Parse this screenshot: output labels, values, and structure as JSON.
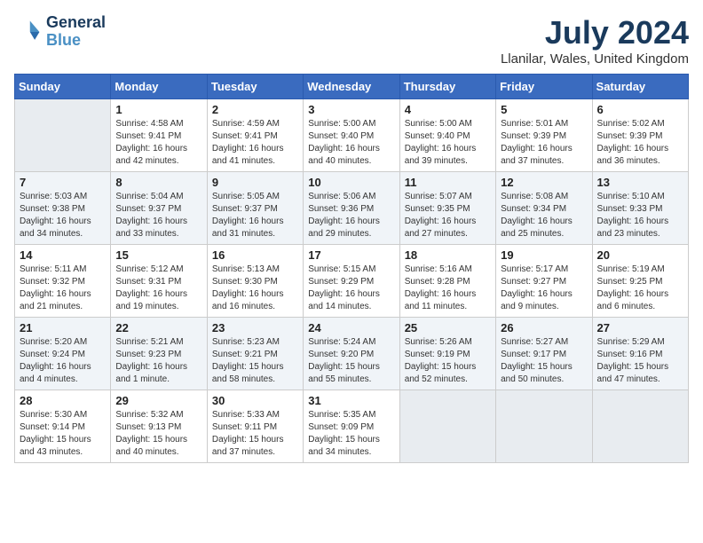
{
  "header": {
    "logo_line1": "General",
    "logo_line2": "Blue",
    "month_title": "July 2024",
    "location": "Llanilar, Wales, United Kingdom"
  },
  "weekdays": [
    "Sunday",
    "Monday",
    "Tuesday",
    "Wednesday",
    "Thursday",
    "Friday",
    "Saturday"
  ],
  "weeks": [
    [
      {
        "day": "",
        "info": ""
      },
      {
        "day": "1",
        "info": "Sunrise: 4:58 AM\nSunset: 9:41 PM\nDaylight: 16 hours\nand 42 minutes."
      },
      {
        "day": "2",
        "info": "Sunrise: 4:59 AM\nSunset: 9:41 PM\nDaylight: 16 hours\nand 41 minutes."
      },
      {
        "day": "3",
        "info": "Sunrise: 5:00 AM\nSunset: 9:40 PM\nDaylight: 16 hours\nand 40 minutes."
      },
      {
        "day": "4",
        "info": "Sunrise: 5:00 AM\nSunset: 9:40 PM\nDaylight: 16 hours\nand 39 minutes."
      },
      {
        "day": "5",
        "info": "Sunrise: 5:01 AM\nSunset: 9:39 PM\nDaylight: 16 hours\nand 37 minutes."
      },
      {
        "day": "6",
        "info": "Sunrise: 5:02 AM\nSunset: 9:39 PM\nDaylight: 16 hours\nand 36 minutes."
      }
    ],
    [
      {
        "day": "7",
        "info": "Sunrise: 5:03 AM\nSunset: 9:38 PM\nDaylight: 16 hours\nand 34 minutes."
      },
      {
        "day": "8",
        "info": "Sunrise: 5:04 AM\nSunset: 9:37 PM\nDaylight: 16 hours\nand 33 minutes."
      },
      {
        "day": "9",
        "info": "Sunrise: 5:05 AM\nSunset: 9:37 PM\nDaylight: 16 hours\nand 31 minutes."
      },
      {
        "day": "10",
        "info": "Sunrise: 5:06 AM\nSunset: 9:36 PM\nDaylight: 16 hours\nand 29 minutes."
      },
      {
        "day": "11",
        "info": "Sunrise: 5:07 AM\nSunset: 9:35 PM\nDaylight: 16 hours\nand 27 minutes."
      },
      {
        "day": "12",
        "info": "Sunrise: 5:08 AM\nSunset: 9:34 PM\nDaylight: 16 hours\nand 25 minutes."
      },
      {
        "day": "13",
        "info": "Sunrise: 5:10 AM\nSunset: 9:33 PM\nDaylight: 16 hours\nand 23 minutes."
      }
    ],
    [
      {
        "day": "14",
        "info": "Sunrise: 5:11 AM\nSunset: 9:32 PM\nDaylight: 16 hours\nand 21 minutes."
      },
      {
        "day": "15",
        "info": "Sunrise: 5:12 AM\nSunset: 9:31 PM\nDaylight: 16 hours\nand 19 minutes."
      },
      {
        "day": "16",
        "info": "Sunrise: 5:13 AM\nSunset: 9:30 PM\nDaylight: 16 hours\nand 16 minutes."
      },
      {
        "day": "17",
        "info": "Sunrise: 5:15 AM\nSunset: 9:29 PM\nDaylight: 16 hours\nand 14 minutes."
      },
      {
        "day": "18",
        "info": "Sunrise: 5:16 AM\nSunset: 9:28 PM\nDaylight: 16 hours\nand 11 minutes."
      },
      {
        "day": "19",
        "info": "Sunrise: 5:17 AM\nSunset: 9:27 PM\nDaylight: 16 hours\nand 9 minutes."
      },
      {
        "day": "20",
        "info": "Sunrise: 5:19 AM\nSunset: 9:25 PM\nDaylight: 16 hours\nand 6 minutes."
      }
    ],
    [
      {
        "day": "21",
        "info": "Sunrise: 5:20 AM\nSunset: 9:24 PM\nDaylight: 16 hours\nand 4 minutes."
      },
      {
        "day": "22",
        "info": "Sunrise: 5:21 AM\nSunset: 9:23 PM\nDaylight: 16 hours\nand 1 minute."
      },
      {
        "day": "23",
        "info": "Sunrise: 5:23 AM\nSunset: 9:21 PM\nDaylight: 15 hours\nand 58 minutes."
      },
      {
        "day": "24",
        "info": "Sunrise: 5:24 AM\nSunset: 9:20 PM\nDaylight: 15 hours\nand 55 minutes."
      },
      {
        "day": "25",
        "info": "Sunrise: 5:26 AM\nSunset: 9:19 PM\nDaylight: 15 hours\nand 52 minutes."
      },
      {
        "day": "26",
        "info": "Sunrise: 5:27 AM\nSunset: 9:17 PM\nDaylight: 15 hours\nand 50 minutes."
      },
      {
        "day": "27",
        "info": "Sunrise: 5:29 AM\nSunset: 9:16 PM\nDaylight: 15 hours\nand 47 minutes."
      }
    ],
    [
      {
        "day": "28",
        "info": "Sunrise: 5:30 AM\nSunset: 9:14 PM\nDaylight: 15 hours\nand 43 minutes."
      },
      {
        "day": "29",
        "info": "Sunrise: 5:32 AM\nSunset: 9:13 PM\nDaylight: 15 hours\nand 40 minutes."
      },
      {
        "day": "30",
        "info": "Sunrise: 5:33 AM\nSunset: 9:11 PM\nDaylight: 15 hours\nand 37 minutes."
      },
      {
        "day": "31",
        "info": "Sunrise: 5:35 AM\nSunset: 9:09 PM\nDaylight: 15 hours\nand 34 minutes."
      },
      {
        "day": "",
        "info": ""
      },
      {
        "day": "",
        "info": ""
      },
      {
        "day": "",
        "info": ""
      }
    ]
  ]
}
